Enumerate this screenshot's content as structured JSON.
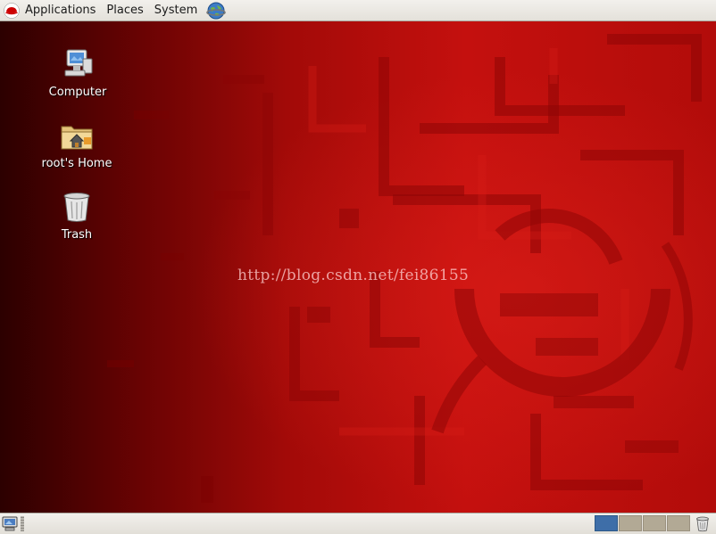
{
  "top_panel": {
    "menus": [
      {
        "label": "Applications",
        "icon": "redhat-logo-icon"
      },
      {
        "label": "Places"
      },
      {
        "label": "System"
      }
    ],
    "launcher_icon": "web-browser-icon"
  },
  "desktop": {
    "icons": [
      {
        "label": "Computer",
        "icon": "computer-icon"
      },
      {
        "label": "root's Home",
        "icon": "home-folder-icon"
      },
      {
        "label": "Trash",
        "icon": "trash-icon"
      }
    ],
    "watermark": "http://blog.csdn.net/fei86155"
  },
  "bottom_panel": {
    "workspaces": [
      {
        "active": true
      },
      {
        "active": false
      },
      {
        "active": false
      },
      {
        "active": false
      }
    ],
    "show_desktop_icon": "show-desktop-icon",
    "trash_icon": "trash-icon"
  },
  "colors": {
    "wallpaper_dark": "#3a0000",
    "wallpaper_red": "#c4100e",
    "active_workspace": "#3e6ea8",
    "inactive_workspace": "#b2a995"
  }
}
